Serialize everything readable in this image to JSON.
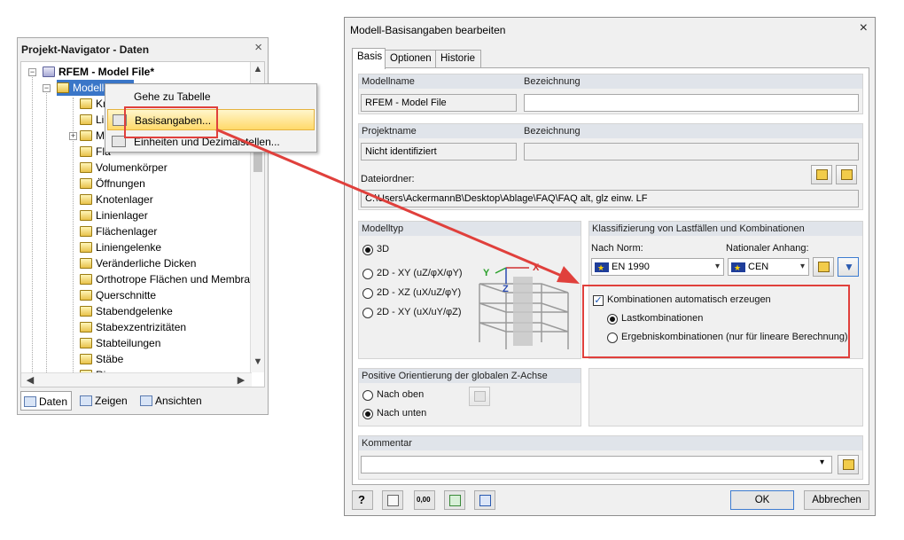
{
  "navigator": {
    "title": "Projekt-Navigator - Daten",
    "close": "×",
    "root_label": "RFEM - Model File*",
    "model_label": "Modelldaten",
    "tree_items": [
      "Kn",
      "Lin",
      "M",
      "Flä",
      "Volumenkörper",
      "Öffnungen",
      "Knotenlager",
      "Linienlager",
      "Flächenlager",
      "Liniengelenke",
      "Veränderliche Dicken",
      "Orthotrope Flächen und Membra",
      "Querschnitte",
      "Stabendgelenke",
      "Stabexzentrizitäten",
      "Stabteilungen",
      "Stäbe",
      "Rippen"
    ],
    "tabs": [
      "Daten",
      "Zeigen",
      "Ansichten"
    ]
  },
  "context_menu": {
    "items": [
      "Gehe zu Tabelle",
      "Basisangaben...",
      "Einheiten und Dezimalstellen..."
    ]
  },
  "dialog": {
    "title": "Modell-Basisangaben bearbeiten",
    "close": "×",
    "tabs": [
      "Basis",
      "Optionen",
      "Historie"
    ],
    "model": {
      "name_header": "Modellname",
      "desc_header": "Bezeichnung",
      "name_value": "RFEM - Model File",
      "desc_value": ""
    },
    "project": {
      "name_header": "Projektname",
      "desc_header": "Bezeichnung",
      "name_value": "Nicht identifiziert",
      "desc_value": "",
      "folder_label": "Dateiordner:",
      "folder_value": "C:\\Users\\AckermannB\\Desktop\\Ablage\\FAQ\\FAQ alt, glz einw. LF"
    },
    "model_type": {
      "header": "Modelltyp",
      "options": [
        "3D",
        "2D - XY (uZ/φX/φY)",
        "2D - XZ (uX/uZ/φY)",
        "2D - XY (uX/uY/φZ)"
      ],
      "selected": "3D",
      "axis_x": "X",
      "axis_y": "Y",
      "axis_z": "Z"
    },
    "classification": {
      "header": "Klassifizierung von Lastfällen und Kombinationen",
      "norm_label": "Nach Norm:",
      "norm_value": "EN 1990",
      "annex_label": "Nationaler Anhang:",
      "annex_value": "CEN",
      "auto_combo_label": "Kombinationen automatisch erzeugen",
      "auto_combo_checked": true,
      "combo_options": [
        "Lastkombinationen",
        "Ergebniskombinationen (nur für lineare Berechnung)"
      ],
      "combo_selected": "Lastkombinationen"
    },
    "orientation": {
      "header": "Positive Orientierung der globalen Z-Achse",
      "options": [
        "Nach oben",
        "Nach unten"
      ],
      "selected": "Nach unten"
    },
    "comment": {
      "header": "Kommentar",
      "value": ""
    },
    "footer": {
      "ok": "OK",
      "cancel": "Abbrechen",
      "units_badge": "0,00"
    }
  },
  "colors": {
    "highlight_red": "#e0403c",
    "group_header": "#e0e4ea",
    "menu_highlight": "#ffd96a",
    "eu_flag": "#1f3e9a"
  }
}
